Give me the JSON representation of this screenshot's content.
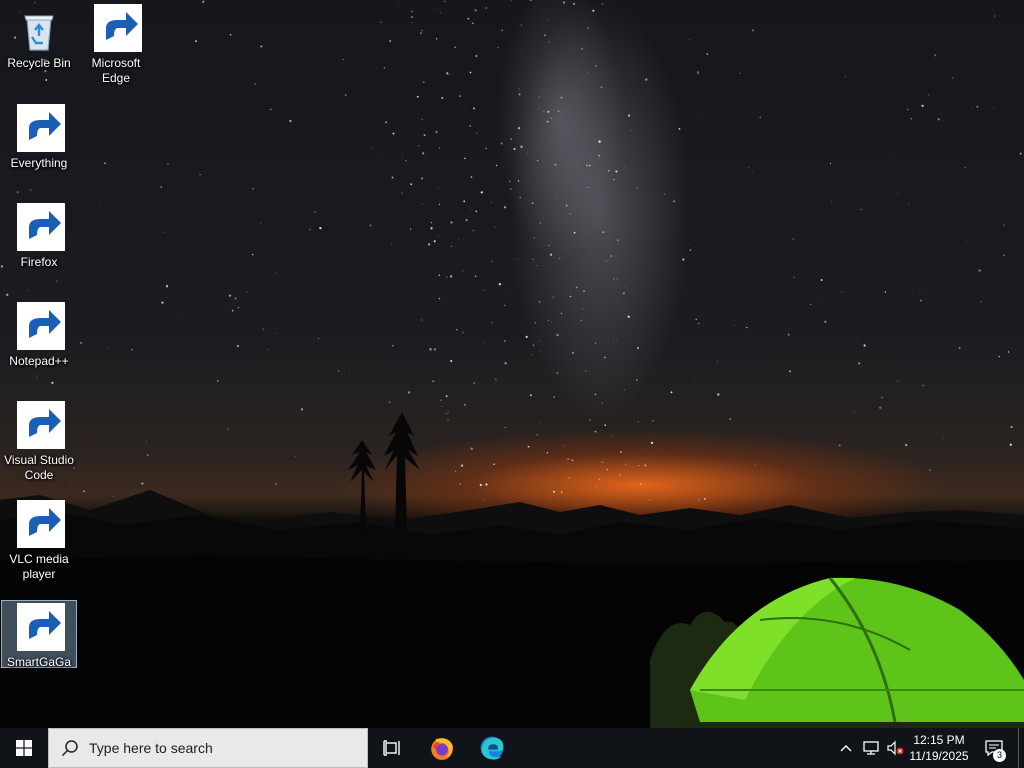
{
  "desktop": {
    "icons": [
      {
        "label": "Recycle Bin",
        "icon": "recycle-bin-icon",
        "selected": false
      },
      {
        "label": "Microsoft\nEdge",
        "icon": "edge-icon",
        "selected": false
      },
      {
        "label": "Everything",
        "icon": "everything-search-icon",
        "selected": false
      },
      {
        "label": "Firefox",
        "icon": "firefox-icon",
        "selected": false
      },
      {
        "label": "Notepad++",
        "icon": "notepad-plus-plus-icon",
        "selected": false
      },
      {
        "label": "Visual Studio\nCode",
        "icon": "vscode-icon",
        "selected": false
      },
      {
        "label": "VLC media\nplayer",
        "icon": "vlc-icon",
        "selected": false
      },
      {
        "label": "SmartGaGa",
        "icon": "smartgaga-icon",
        "selected": true
      }
    ]
  },
  "taskbar": {
    "start_icon": "windows-logo-icon",
    "search_placeholder": "Type here to search",
    "search_icon": "search-icon",
    "taskview_icon": "task-view-icon",
    "pinned": [
      {
        "name": "Firefox",
        "icon": "firefox-icon"
      },
      {
        "name": "Microsoft Edge",
        "icon": "edge-icon"
      }
    ],
    "tray": {
      "chevron_icon": "chevron-up-icon",
      "network_icon": "network-icon",
      "volume_icon": "volume-muted-icon",
      "time": "12:15 PM",
      "date": "11/19/2025",
      "notification_icon": "notification-icon",
      "notification_count": "3"
    },
    "background": "#101418"
  }
}
